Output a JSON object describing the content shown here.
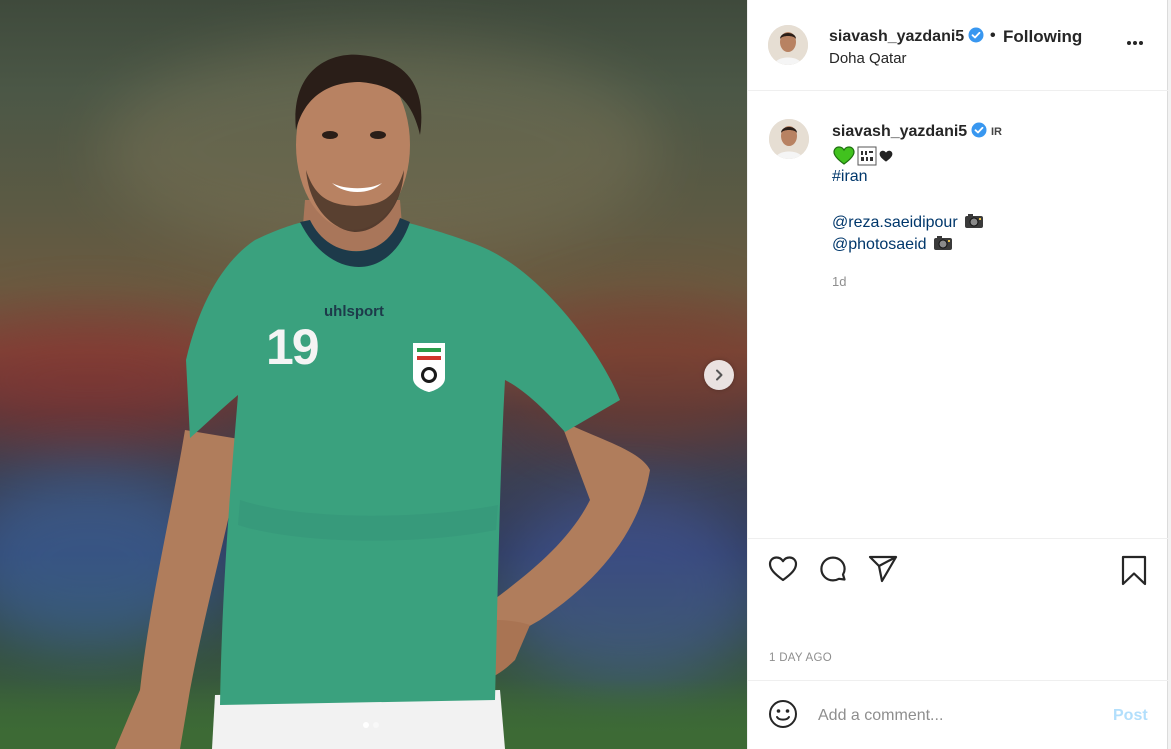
{
  "post": {
    "username": "siavash_yazdani5",
    "follow_separator": "•",
    "follow_label": "Following",
    "location": "Doha Qatar"
  },
  "caption": {
    "username": "siavash_yazdani5",
    "country_code": "IR",
    "hashtag": "#iran",
    "mentions": [
      "@reza.saeidipour",
      "@photosaeid"
    ],
    "time_ago": "1d"
  },
  "photo": {
    "jersey_brand": "uhlsport",
    "jersey_number": "19"
  },
  "actions": {
    "date": "1 DAY AGO"
  },
  "comment": {
    "placeholder": "Add a comment...",
    "post_label": "Post"
  },
  "carousel": {
    "slide_count": 2,
    "active_slide": 1
  },
  "colors": {
    "jersey_green": "#3aa17e",
    "link_blue": "#00376b",
    "verified_blue": "#3897f0",
    "post_disabled": "#b2dffc"
  },
  "icons": [
    "verified-badge-icon",
    "more-options-icon",
    "heart-icon",
    "comment-icon",
    "share-icon",
    "bookmark-icon",
    "smiley-icon",
    "chevron-right-icon",
    "camera-emoji-icon",
    "green-heart-emoji-icon",
    "black-heart-emoji-icon",
    "flag-emoji-icon"
  ]
}
